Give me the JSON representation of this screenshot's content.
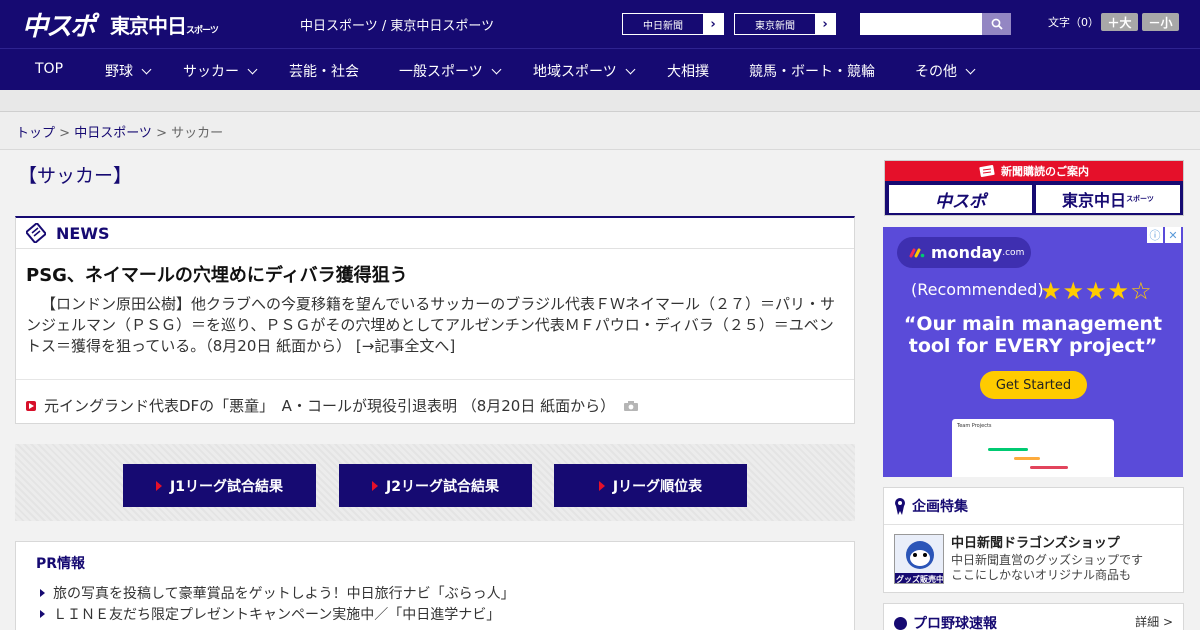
{
  "header": {
    "logo_primary": "中スポ",
    "logo_secondary": "東京中日",
    "logo_secondary_small": "スポーツ",
    "sites_text": "中日スポーツ / 東京中日スポーツ",
    "site_buttons": [
      {
        "label": "中日新聞"
      },
      {
        "label": "東京新聞"
      }
    ],
    "search_placeholder": "",
    "font_size_label": "文字（0）",
    "font_bigger": "＋大",
    "font_smaller": "－小"
  },
  "nav": {
    "items": [
      {
        "label": "TOP",
        "dropdown": false
      },
      {
        "label": "野球",
        "dropdown": true
      },
      {
        "label": "サッカー",
        "dropdown": true
      },
      {
        "label": "芸能・社会",
        "dropdown": false
      },
      {
        "label": "一般スポーツ",
        "dropdown": true
      },
      {
        "label": "地域スポーツ",
        "dropdown": true
      },
      {
        "label": "大相撲",
        "dropdown": false
      },
      {
        "label": "競馬・ボート・競輪",
        "dropdown": false
      },
      {
        "label": "その他",
        "dropdown": true
      }
    ]
  },
  "breadcrumb": {
    "items": [
      "トップ",
      "中日スポーツ",
      "サッカー"
    ],
    "sep": " > "
  },
  "page": {
    "title": "【サッカー】"
  },
  "news": {
    "section_label": "NEWS",
    "headline": "PSG、ネイマールの穴埋めにディバラ獲得狙う",
    "body": "【ロンドン原田公樹】他クラブへの今夏移籍を望んでいるサッカーのブラジル代表ＦＷネイマール（２７）＝パリ・サンジェルマン（ＰＳＧ）＝を巡り、ＰＳＧがその穴埋めとしてアルゼンチン代表ＭＦパウロ・ディバラ（２５）＝ユベントス＝獲得を狙っている。（8月20日 紙面から） [→記事全文へ]",
    "sub_item": "元イングランド代表DFの「悪童」　A・コールが現役引退表明 （8月20日 紙面から）"
  },
  "jleague": {
    "buttons": [
      "J1リーグ試合結果",
      "J2リーグ試合結果",
      "Jリーグ順位表"
    ]
  },
  "pr": {
    "title": "PR情報",
    "items": [
      "旅の写真を投稿して豪華賞品をゲットしよう！中日旅行ナビ「ぶらっ人」",
      "ＬＩＮＥ友だち限定プレゼントキャンペーン実施中／「中日進学ナビ」"
    ]
  },
  "sidebar": {
    "subscribe": {
      "label": "新聞購読のご案内",
      "logo1": "中スポ",
      "logo2": "東京中日",
      "logo2_small": "スポーツ"
    },
    "ad": {
      "brand": "monday",
      "brand_suffix": ".com",
      "recommended": "(Recommended)",
      "stars": "★★★★☆",
      "quote": "“Our main management tool for EVERY project”",
      "cta": "Get Started",
      "shot_title": "Team Projects"
    },
    "kikaku": {
      "title": "企画特集",
      "name": "中日新聞ドラゴンズショップ",
      "desc_lines": [
        "中日新聞直営のグッズショップです",
        "ここにしかないオリジナル商品も"
      ],
      "badge": "グッズ販売中"
    },
    "baseball": {
      "title": "プロ野球速報",
      "more": "詳細 >"
    }
  },
  "colors": {
    "brand_navy": "#160a72",
    "accent_red": "#e5102a",
    "ad_purple": "#5a4bd9",
    "cta_yellow": "#ffcb00"
  }
}
